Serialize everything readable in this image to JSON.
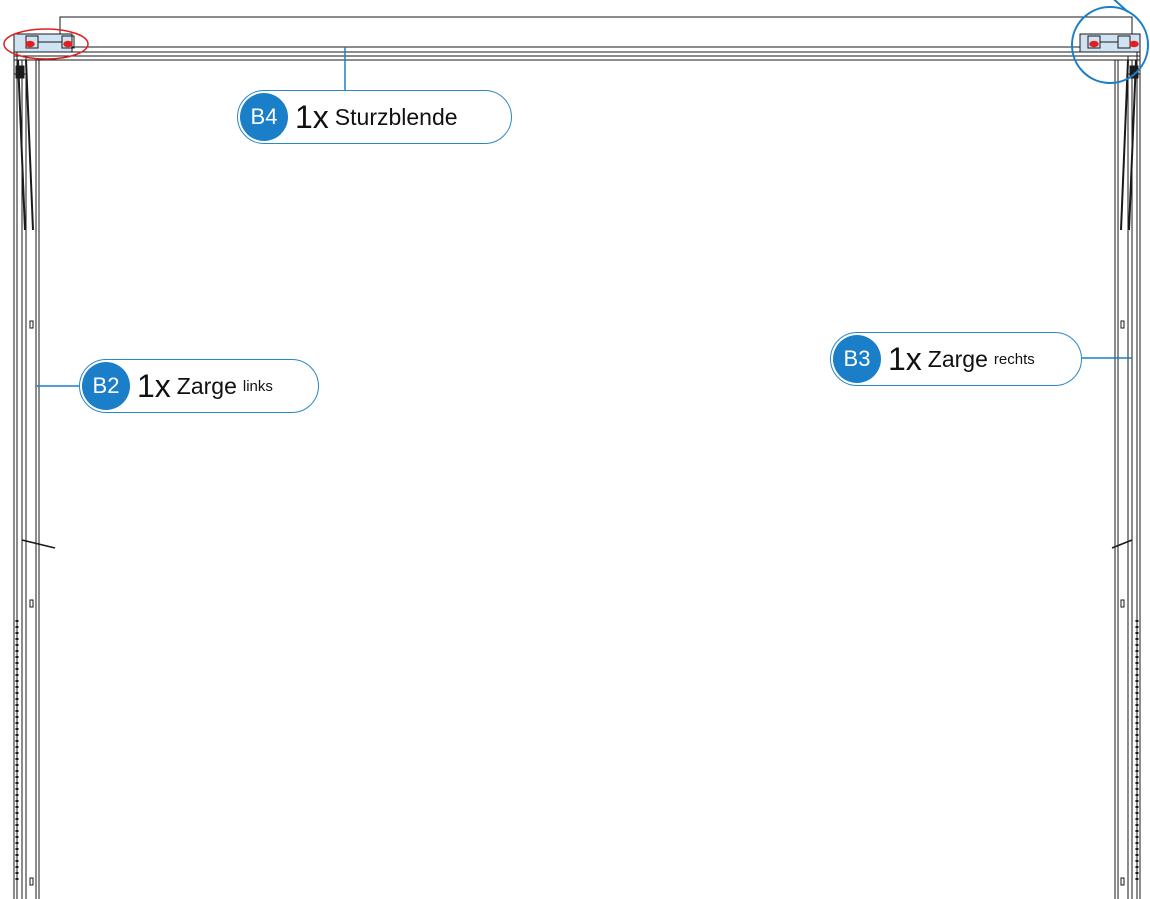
{
  "drawing": {
    "colors": {
      "line": "#1a1a1a",
      "accent_blue": "#1a7fc8",
      "highlight_red": "#e02020",
      "highlight_fill": "#cfe3f2"
    }
  },
  "callouts": [
    {
      "id": "B4",
      "qty": "1x",
      "part": "Sturzblende",
      "sub": ""
    },
    {
      "id": "B2",
      "qty": "1x",
      "part": "Zarge",
      "sub": "links"
    },
    {
      "id": "B3",
      "qty": "1x",
      "part": "Zarge",
      "sub": "rechts"
    }
  ]
}
